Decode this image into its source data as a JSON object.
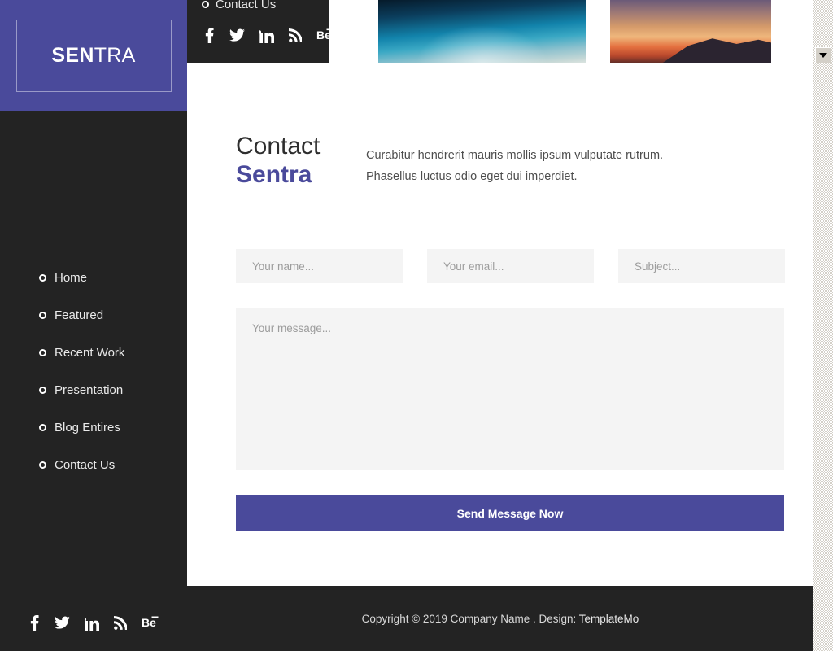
{
  "logo": {
    "bold_part": "SEN",
    "light_part": "TRA"
  },
  "sidebar": {
    "items": [
      {
        "label": "Home",
        "icon": "circle-bullet-icon"
      },
      {
        "label": "Featured",
        "icon": "circle-bullet-icon"
      },
      {
        "label": "Recent Work",
        "icon": "circle-bullet-icon"
      },
      {
        "label": "Presentation",
        "icon": "circle-bullet-icon"
      },
      {
        "label": "Blog Entires",
        "icon": "circle-bullet-icon"
      },
      {
        "label": "Contact Us",
        "icon": "circle-bullet-icon"
      }
    ],
    "social": [
      {
        "name": "facebook-icon",
        "label": "f"
      },
      {
        "name": "twitter-icon",
        "label": "Twitter"
      },
      {
        "name": "linkedin-icon",
        "label": "in"
      },
      {
        "name": "rss-icon",
        "label": "RSS"
      },
      {
        "name": "behance-icon",
        "label": "Be"
      }
    ]
  },
  "overflow_panel": {
    "nav_label": "Contact Us"
  },
  "thumbnails": [
    {
      "name": "blue-sky-thumbnail",
      "alt": "blue night sky with light rays"
    },
    {
      "name": "sunset-mountain-thumbnail",
      "alt": "orange sunset over mountain ridge"
    }
  ],
  "contact": {
    "heading_line1": "Contact",
    "heading_line2": "Sentra",
    "description_line1": "Curabitur hendrerit mauris mollis ipsum vulputate rutrum.",
    "description_line2": "Phasellus luctus odio eget dui imperdiet.",
    "form": {
      "name_placeholder": "Your name...",
      "name_value": "",
      "email_placeholder": "Your email...",
      "email_value": "",
      "subject_placeholder": "Subject...",
      "subject_value": "",
      "message_placeholder": "Your message...",
      "message_value": "",
      "submit_label": "Send Message Now"
    }
  },
  "footer": {
    "copyright_prefix": "Copyright © 2019 Company Name . Design: ",
    "design_link": "TemplateMo"
  },
  "scrollbar": {
    "down_arrow": "chevron-down-icon"
  },
  "colors": {
    "brand_purple": "#4a4a9b",
    "sidebar_dark": "#232323",
    "field_grey": "#f4f4f4",
    "text_dark": "#2e2e2e"
  }
}
